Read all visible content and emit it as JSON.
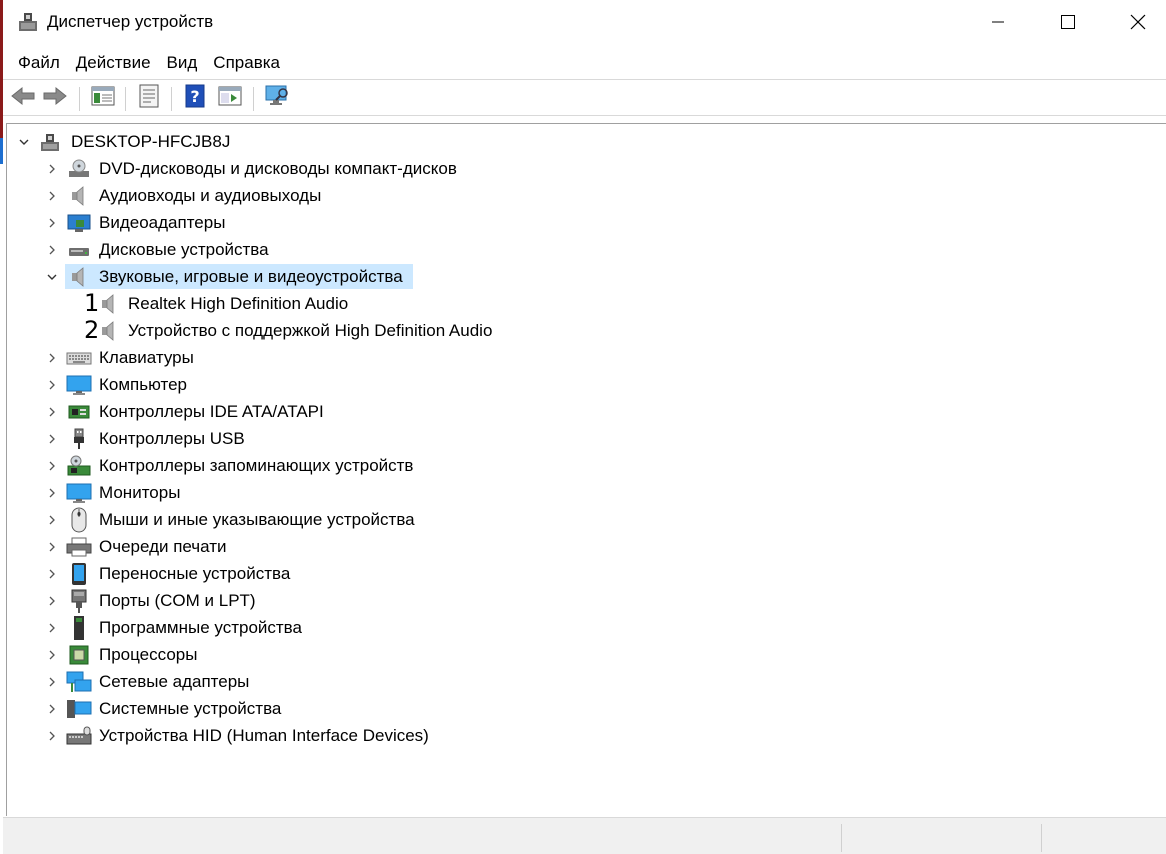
{
  "window": {
    "title": "Диспетчер устройств"
  },
  "menu": [
    "Файл",
    "Действие",
    "Вид",
    "Справка"
  ],
  "toolbar": {
    "icons": [
      "back-arrow-icon",
      "forward-arrow-icon",
      "show-hide-tree-icon",
      "properties-icon",
      "help-icon",
      "show-view-icon",
      "scan-hardware-icon"
    ]
  },
  "tree": {
    "root": "DESKTOP-HFCJB8J",
    "categories": [
      {
        "label": "DVD-дисководы и дисководы компакт-дисков",
        "icon": "dvd-drive-icon",
        "expanded": false
      },
      {
        "label": "Аудиовходы и аудиовыходы",
        "icon": "speaker-icon",
        "expanded": false
      },
      {
        "label": "Видеоадаптеры",
        "icon": "display-adapter-icon",
        "expanded": false
      },
      {
        "label": "Дисковые устройства",
        "icon": "disk-drive-icon",
        "expanded": false
      },
      {
        "label": "Звуковые, игровые и видеоустройства",
        "icon": "speaker-icon",
        "expanded": true,
        "selected": true,
        "children": [
          {
            "marker": "1",
            "label": "Realtek High Definition Audio",
            "icon": "speaker-icon"
          },
          {
            "marker": "2",
            "label": "Устройство с поддержкой High Definition Audio",
            "icon": "speaker-icon"
          }
        ]
      },
      {
        "label": "Клавиатуры",
        "icon": "keyboard-icon",
        "expanded": false
      },
      {
        "label": "Компьютер",
        "icon": "monitor-icon",
        "expanded": false
      },
      {
        "label": "Контроллеры IDE ATA/ATAPI",
        "icon": "ide-controller-icon",
        "expanded": false
      },
      {
        "label": "Контроллеры USB",
        "icon": "usb-icon",
        "expanded": false
      },
      {
        "label": "Контроллеры запоминающих устройств",
        "icon": "storage-controller-icon",
        "expanded": false
      },
      {
        "label": "Мониторы",
        "icon": "monitor-icon",
        "expanded": false
      },
      {
        "label": "Мыши и иные указывающие устройства",
        "icon": "mouse-icon",
        "expanded": false
      },
      {
        "label": "Очереди печати",
        "icon": "printer-icon",
        "expanded": false
      },
      {
        "label": "Переносные устройства",
        "icon": "portable-device-icon",
        "expanded": false
      },
      {
        "label": "Порты (COM и LPT)",
        "icon": "port-icon",
        "expanded": false
      },
      {
        "label": "Программные устройства",
        "icon": "software-device-icon",
        "expanded": false
      },
      {
        "label": "Процессоры",
        "icon": "processor-icon",
        "expanded": false
      },
      {
        "label": "Сетевые адаптеры",
        "icon": "network-adapter-icon",
        "expanded": false
      },
      {
        "label": "Системные устройства",
        "icon": "system-device-icon",
        "expanded": false
      },
      {
        "label": "Устройства HID (Human Interface Devices)",
        "icon": "hid-icon",
        "expanded": false
      }
    ]
  },
  "colors": {
    "selection": "#cce8ff",
    "accent": "#1e6fd0"
  }
}
